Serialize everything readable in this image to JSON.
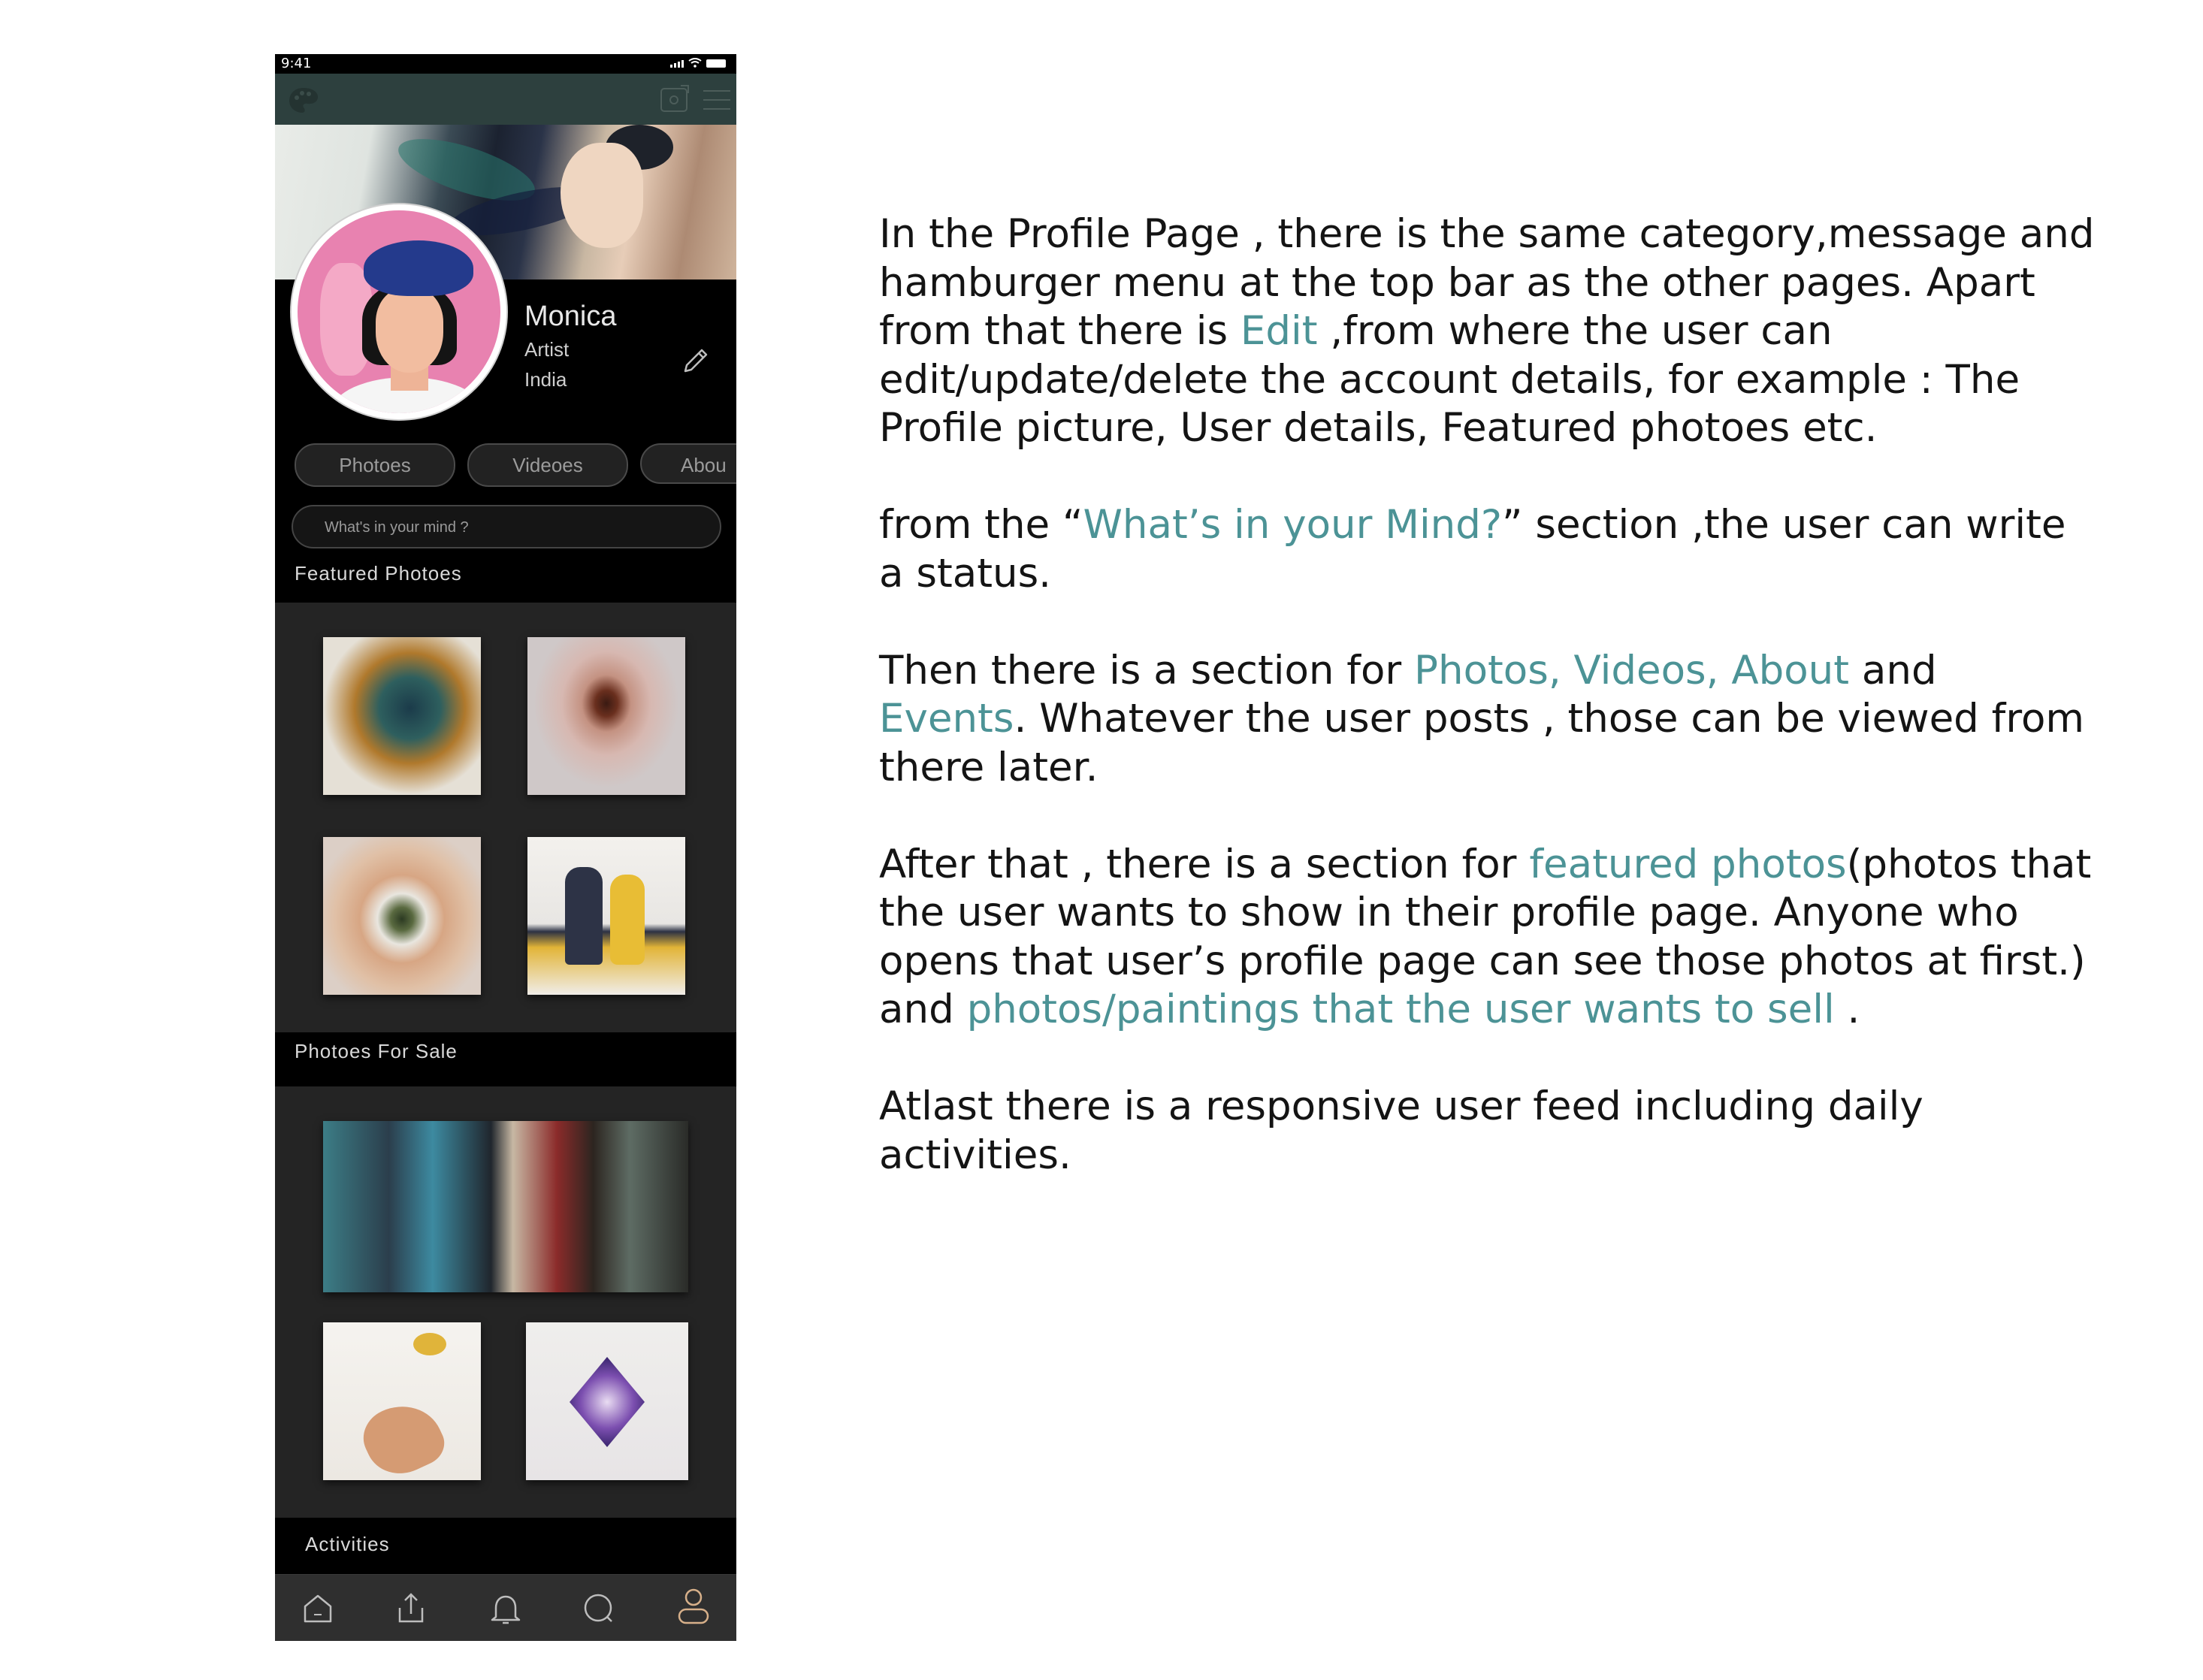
{
  "colors": {
    "accent": "#4c9396",
    "topbar": "#2d403e",
    "panel": "#242424",
    "phone_bg": "#000000"
  },
  "statusbar": {
    "time": "9:41"
  },
  "topbar": {
    "icons": [
      "palette-icon",
      "message-icon",
      "hamburger-menu-icon"
    ]
  },
  "profile": {
    "name": "Monica",
    "role": "Artist",
    "location": "India"
  },
  "tabs": [
    "Photoes",
    "Videoes",
    "Abou"
  ],
  "status_input": {
    "placeholder": "What's in your mind ?"
  },
  "sections": {
    "featured": "Featured Photoes",
    "for_sale": "Photoes For Sale",
    "activities": "Activities"
  },
  "bottom_nav": [
    "home-icon",
    "upload-icon",
    "notification-bell-icon",
    "search-icon",
    "profile-icon"
  ],
  "description": {
    "p1": [
      {
        "t": "In the Profile Page , there is the same category,message and hamburger menu at the top bar as the other pages. Apart from that there is "
      },
      {
        "t": "Edit",
        "hl": true
      },
      {
        "t": " ,from where the user can edit/update/delete the account details, for example : The Profile picture, User details, Featured photoes etc."
      }
    ],
    "p2": [
      {
        "t": "from the “"
      },
      {
        "t": "What’s in your Mind?",
        "hl": true
      },
      {
        "t": "” section ,the user can write a status."
      }
    ],
    "p3": [
      {
        "t": "Then there is a section for "
      },
      {
        "t": "Photos, Videos, About",
        "hl": true
      },
      {
        "t": " and "
      },
      {
        "t": "Events",
        "hl": true
      },
      {
        "t": ". Whatever the user posts , those can be viewed from there later."
      }
    ],
    "p4": [
      {
        "t": "After that , there is a section for "
      },
      {
        "t": "featured photos",
        "hl": true
      },
      {
        "t": "(photos that the user wants to show in their profile page. Anyone who opens that user’s profile page can see those photos at first.) and "
      },
      {
        "t": "photos/paintings that the user wants to sell",
        "hl": true
      },
      {
        "t": " ."
      }
    ],
    "p5": [
      {
        "t": "Atlast there is a responsive user feed including daily activities."
      }
    ]
  }
}
